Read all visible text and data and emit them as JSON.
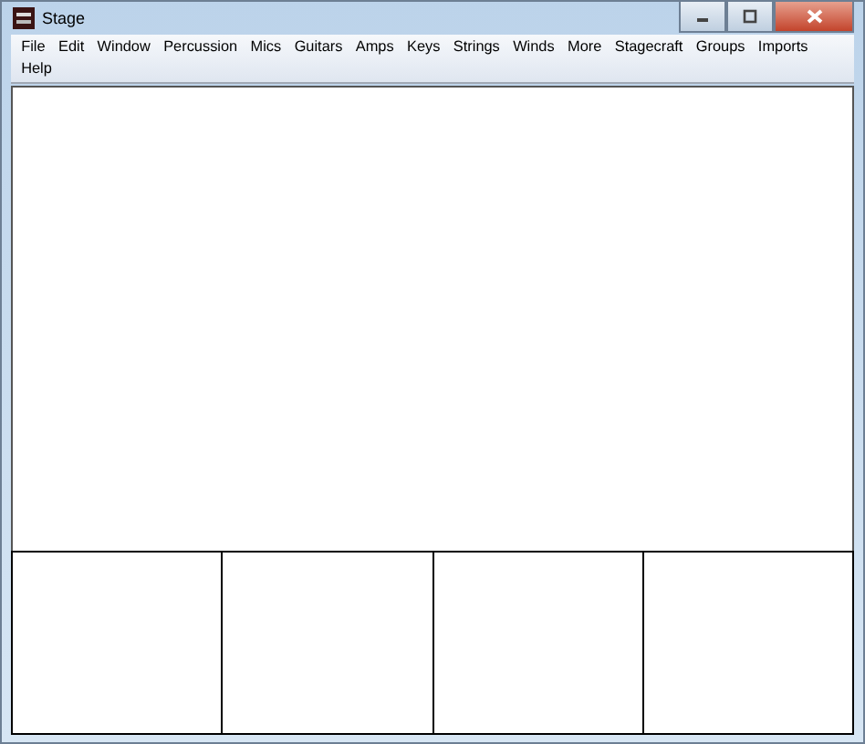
{
  "window": {
    "title": "Stage"
  },
  "menu": [
    "File",
    "Edit",
    "Window",
    "Percussion",
    "Mics",
    "Guitars",
    "Amps",
    "Keys",
    "Strings",
    "Winds",
    "More",
    "Stagecraft",
    "Groups",
    "Imports",
    "Help"
  ]
}
